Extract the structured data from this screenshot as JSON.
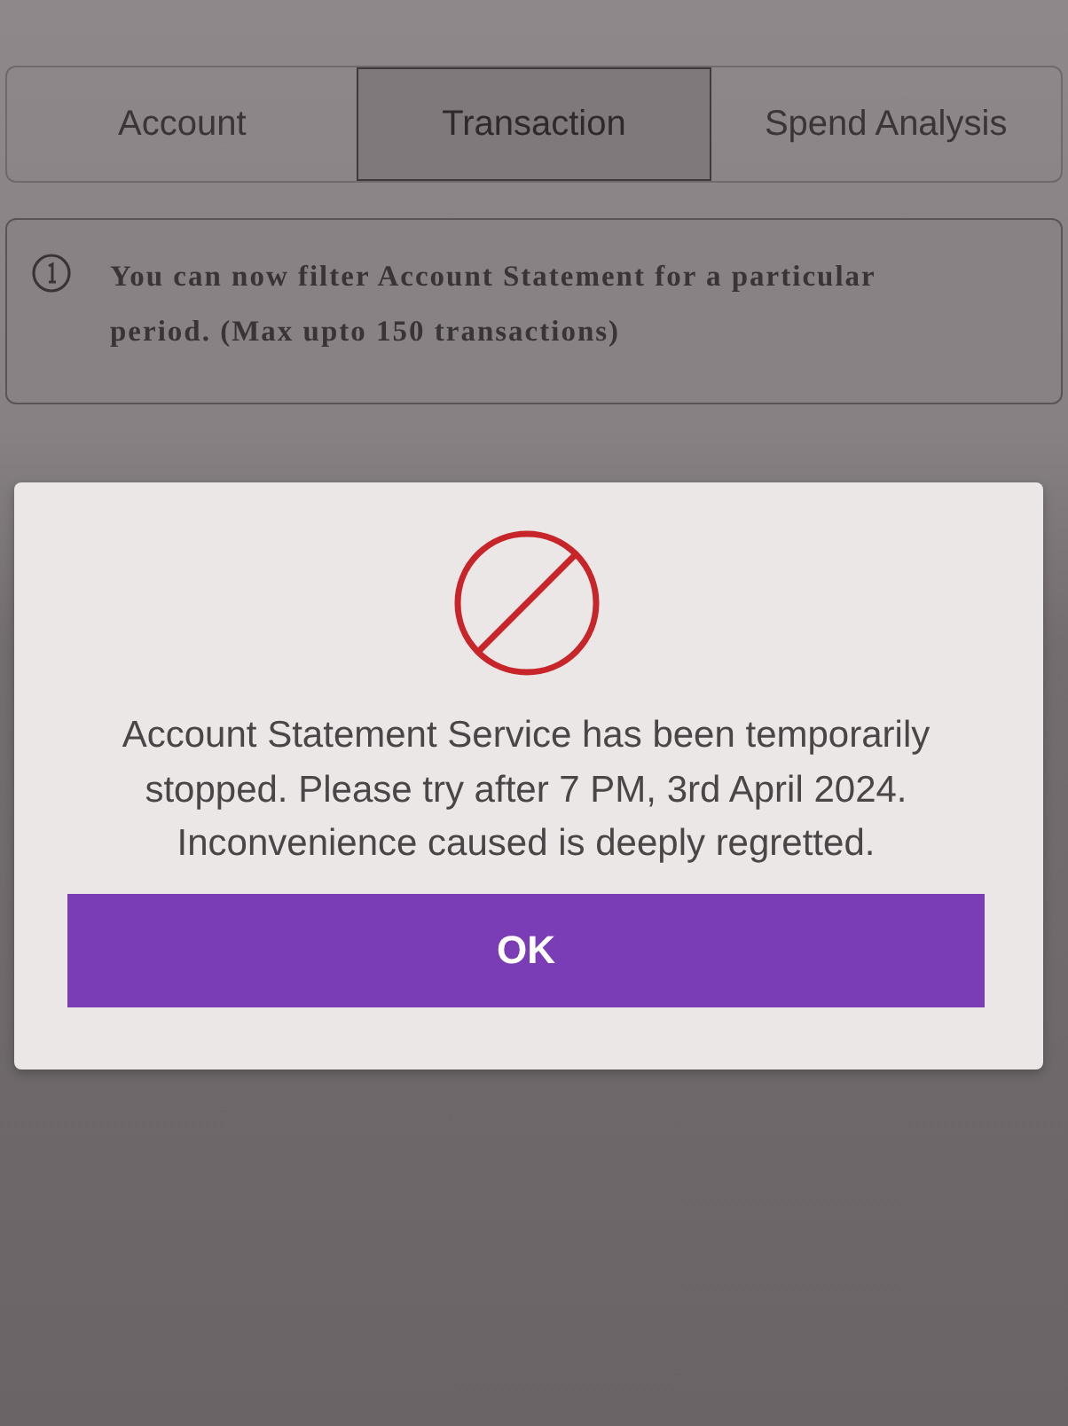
{
  "tabs": [
    {
      "label": "Account",
      "selected": false
    },
    {
      "label": "Transaction",
      "selected": true
    },
    {
      "label": "Spend Analysis",
      "selected": false
    }
  ],
  "notice": {
    "text": "You can now filter Account Statement for a particular period. (Max upto 150 transactions)"
  },
  "dialog": {
    "message": "Account Statement Service has been temporarily stopped. Please try after 7 PM, 3rd April 2024. Inconvenience caused is deeply regretted.",
    "button": "OK"
  }
}
